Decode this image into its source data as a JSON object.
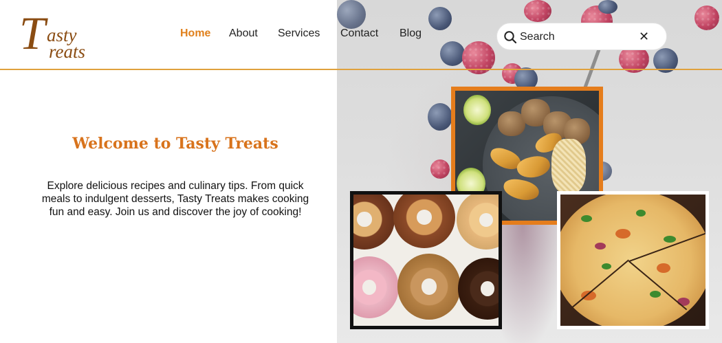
{
  "brand": {
    "logo_line1": "asty",
    "logo_line2": "reats",
    "logo_initial": "T"
  },
  "nav": {
    "items": [
      {
        "label": "Home",
        "active": true
      },
      {
        "label": "About",
        "active": false
      },
      {
        "label": "Services",
        "active": false
      },
      {
        "label": "Contact",
        "active": false
      },
      {
        "label": "Blog",
        "active": false
      }
    ]
  },
  "search": {
    "placeholder": "Search",
    "clear_symbol": "✕"
  },
  "main": {
    "title": "Welcome to Tasty Treats",
    "intro": "Explore delicious recipes and culinary tips. From quick meals to indulgent desserts, Tasty Treats makes cooking fun and easy. Join us and discover the joy of cooking!"
  },
  "colors": {
    "accent": "#e0801c",
    "title": "#d8731c",
    "header_rule": "#e0a13c",
    "logo": "#8a4c12"
  },
  "icons": [
    "search-icon",
    "close-icon"
  ]
}
